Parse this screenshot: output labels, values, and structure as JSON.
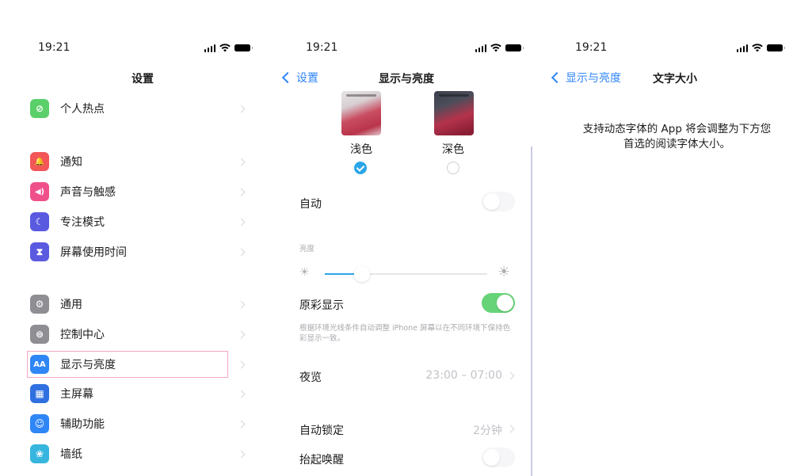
{
  "panel1": {
    "time": "19:21",
    "title": "设置",
    "items": [
      {
        "label": "个人热点",
        "icon": "hotspot-icon",
        "color": "#5bcf6a",
        "glyph": "⊘"
      },
      {
        "label": "通知",
        "icon": "notification-icon",
        "color": "#f25656",
        "glyph": "🔔"
      },
      {
        "label": "声音与触感",
        "icon": "sound-icon",
        "color": "#f0508a",
        "glyph": "◀)"
      },
      {
        "label": "专注模式",
        "icon": "moon-icon",
        "color": "#5a5ae0",
        "glyph": "☾"
      },
      {
        "label": "屏幕使用时间",
        "icon": "hourglass-icon",
        "color": "#5a5ae0",
        "glyph": "⧗"
      },
      {
        "label": "通用",
        "icon": "gear-icon",
        "color": "#8e8e93",
        "glyph": "⚙"
      },
      {
        "label": "控制中心",
        "icon": "toggles-icon",
        "color": "#8e8e93",
        "glyph": "⊜"
      },
      {
        "label": "显示与亮度",
        "icon": "display-icon",
        "color": "#2f86f6",
        "glyph": "AA"
      },
      {
        "label": "主屏幕",
        "icon": "home-screen-icon",
        "color": "#2f6fe0",
        "glyph": "▦"
      },
      {
        "label": "辅助功能",
        "icon": "accessibility-icon",
        "color": "#2f86f6",
        "glyph": "☺"
      },
      {
        "label": "墙纸",
        "icon": "wallpaper-icon",
        "color": "#36b6de",
        "glyph": "❀"
      }
    ]
  },
  "panel2": {
    "time": "19:21",
    "back": "设置",
    "title": "显示与亮度",
    "light": "浅色",
    "dark": "深色",
    "auto": "自动",
    "brightness": "亮度",
    "brightness_level": 0.18,
    "truetone": "原彩显示",
    "truetone_desc": "根据环境光线条件自动调整 iPhone 屏幕以在不同环境下保持色彩显示一致。",
    "nightshift": "夜览",
    "nightshift_value": "23:00 – 07:00",
    "autolock": "自动锁定",
    "autolock_value": "2分钟",
    "raise": "抬起唤醒"
  },
  "panel3": {
    "time": "19:21",
    "back": "显示与亮度",
    "title": "文字大小",
    "desc_line1": "支持动态字体的 App 将会调整为下方您",
    "desc_line2": "首选的阅读字体大小。"
  }
}
